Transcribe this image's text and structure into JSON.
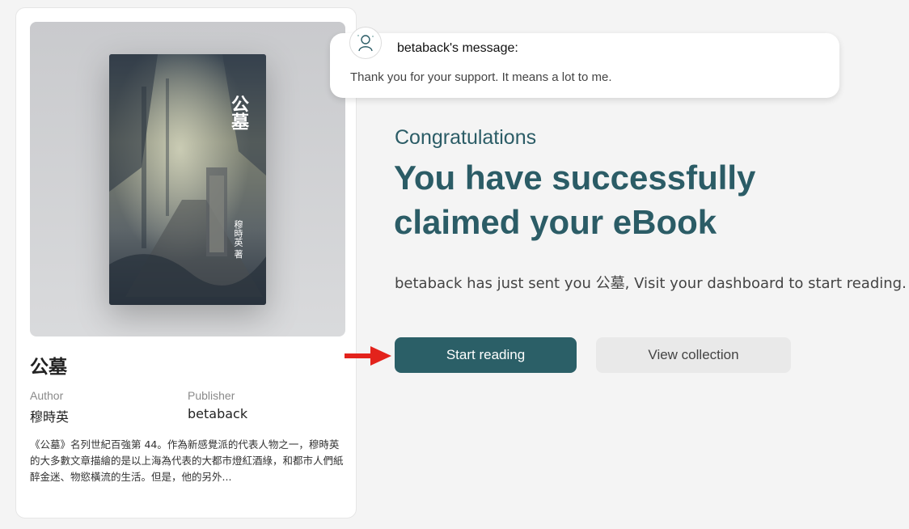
{
  "book": {
    "title": "公墓",
    "cover_title": "公墓",
    "cover_author": "穆時英 著",
    "author_label": "Author",
    "author": "穆時英",
    "publisher_label": "Publisher",
    "publisher": "betaback",
    "description": "《公墓》名列世紀百強第 44。作為新感覺派的代表人物之一，穆時英的大多數文章描繪的是以上海為代表的大都市燈紅酒綠，和都市人們紙醉金迷、物慾橫流的生活。但是，他的另外..."
  },
  "message": {
    "sender": "betaback's message:",
    "text": "Thank you for your support. It means a lot to me."
  },
  "main": {
    "congrats": "Congratulations",
    "headline": "You have successfully claimed your eBook",
    "subtext": "betaback has just sent you 公墓, Visit your dashboard to start reading."
  },
  "actions": {
    "start_reading": "Start reading",
    "view_collection": "View collection"
  },
  "colors": {
    "accent": "#2b5f67",
    "heading": "#2b5c66",
    "arrow": "#e3231c"
  }
}
